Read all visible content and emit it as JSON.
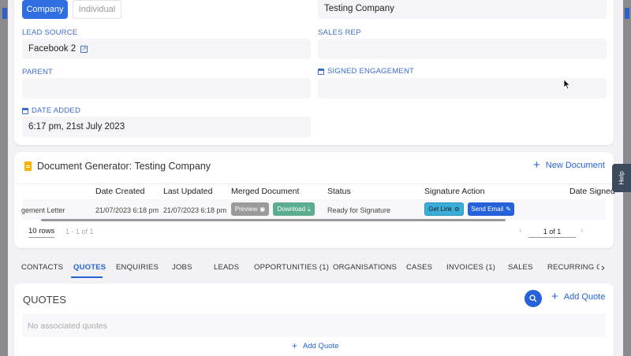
{
  "top_card": {
    "type_toggle": {
      "company_label": "Company",
      "individual_label": "Individual"
    },
    "company_name_value": "Testing Company",
    "lead_source": {
      "label": "LEAD SOURCE",
      "value": "Facebook 2"
    },
    "sales_rep": {
      "label": "SALES REP",
      "value": ""
    },
    "parent": {
      "label": "PARENT",
      "value": ""
    },
    "signed_engagement": {
      "label": "SIGNED ENGAGEMENT",
      "value": ""
    },
    "date_added": {
      "label": "DATE ADDED",
      "value": "6:17 pm, 21st July 2023"
    }
  },
  "doc_generator": {
    "title": "Document Generator: Testing Company",
    "new_document_label": "New Document",
    "columns": [
      "Date Created",
      "Last Updated",
      "Merged Document",
      "Status",
      "Signature Action",
      "Date Signed"
    ],
    "row": {
      "name": "gement Letter",
      "date_created": "21/07/2023 6:18 pm",
      "last_updated": "21/07/2023 6:18 pm",
      "preview_label": "Preview",
      "download_label": "Download",
      "status": "Ready for Signature",
      "get_link_label": "Get Link",
      "send_email_label": "Send Email"
    },
    "rows_per_page": "10 rows",
    "range_text": "1 - 1 of 1",
    "page_text": "1 of 1"
  },
  "help_label": "Help",
  "tabs": [
    {
      "label": "CONTACTS"
    },
    {
      "label": "QUOTES"
    },
    {
      "label": "ENQUIRIES"
    },
    {
      "label": "JOBS"
    },
    {
      "label": "LEADS"
    },
    {
      "label": "OPPORTUNITIES (1)"
    },
    {
      "label": "ORGANISATIONS"
    },
    {
      "label": "CASES"
    },
    {
      "label": "INVOICES (1)"
    },
    {
      "label": "SALES"
    },
    {
      "label": "RECURRING CH"
    }
  ],
  "quotes": {
    "title": "QUOTES",
    "add_quote_label": "Add Quote",
    "empty_text": "No associated quotes",
    "add_quote_bottom_label": "Add Quote"
  },
  "colors": {
    "accent": "#2562d9",
    "download": "#5aae8f",
    "get_link": "#3aaed8",
    "preview": "#9a9a9a"
  },
  "icons": [
    "external-link-icon",
    "calendar-icon",
    "document-icon",
    "plus-icon",
    "eye-icon",
    "download-icon",
    "link-icon",
    "send-icon",
    "search-icon",
    "chevron-left-icon",
    "chevron-right-icon",
    "mouse-cursor-icon"
  ]
}
